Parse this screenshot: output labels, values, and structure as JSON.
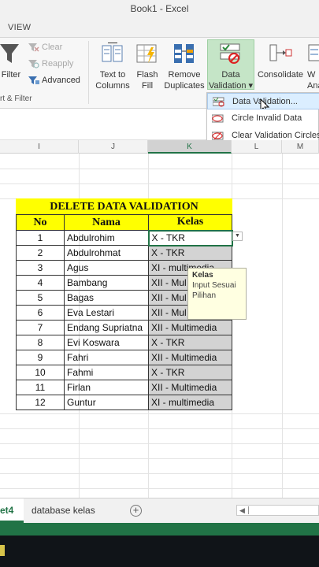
{
  "window": {
    "title": "Book1 - Excel"
  },
  "ribbon_tab": "VIEW",
  "ribbon": {
    "filter": "Filter",
    "clear": "Clear",
    "reapply": "Reapply",
    "advanced": "Advanced",
    "group_sort_filter": "rt & Filter",
    "text_to_columns_1": "Text to",
    "text_to_columns_2": "Columns",
    "flash_fill_1": "Flash",
    "flash_fill_2": "Fill",
    "remove_dup_1": "Remove",
    "remove_dup_2": "Duplicates",
    "data_validation_1": "Data",
    "data_validation_2": "Validation ▾",
    "consolidate": "Consolidate",
    "whatif_1": "W",
    "whatif_2": "Ana"
  },
  "dropdown": {
    "items": [
      {
        "label": "Data Validation..."
      },
      {
        "label": "Circle Invalid Data"
      },
      {
        "label": "Clear Validation Circles"
      }
    ]
  },
  "columns": [
    "I",
    "J",
    "K",
    "L",
    "M"
  ],
  "table": {
    "title": "DELETE DATA VALIDATION",
    "headers": [
      "No",
      "Nama",
      "Kelas"
    ],
    "rows": [
      {
        "no": "1",
        "nama": "Abdulrohim",
        "kelas": "X - TKR"
      },
      {
        "no": "2",
        "nama": "Abdulrohmat",
        "kelas": "X - TKR"
      },
      {
        "no": "3",
        "nama": "Agus",
        "kelas": "XI - multimedia"
      },
      {
        "no": "4",
        "nama": "Bambang",
        "kelas": "XII - Mul"
      },
      {
        "no": "5",
        "nama": "Bagas",
        "kelas": "XII - Mul"
      },
      {
        "no": "6",
        "nama": "Eva Lestari",
        "kelas": "XII - Mul"
      },
      {
        "no": "7",
        "nama": "Endang Supriatna",
        "kelas": "XII - Multimedia"
      },
      {
        "no": "8",
        "nama": "Evi Koswara",
        "kelas": "X - TKR"
      },
      {
        "no": "9",
        "nama": "Fahri",
        "kelas": "XII - Multimedia"
      },
      {
        "no": "10",
        "nama": "Fahmi",
        "kelas": "X - TKR"
      },
      {
        "no": "11",
        "nama": "Firlan",
        "kelas": "XII - Multimedia"
      },
      {
        "no": "12",
        "nama": "Guntur",
        "kelas": "XI - multimedia"
      }
    ]
  },
  "tooltip": {
    "title": "Kelas",
    "line1": "Input Sesuai",
    "line2": "Pilihan"
  },
  "sheets": {
    "active": "et4",
    "other": "database kelas",
    "add": "+"
  },
  "colors": {
    "excel_green": "#217346",
    "header_yellow": "#ffff00",
    "validation_gray": "#d3d3d3"
  }
}
